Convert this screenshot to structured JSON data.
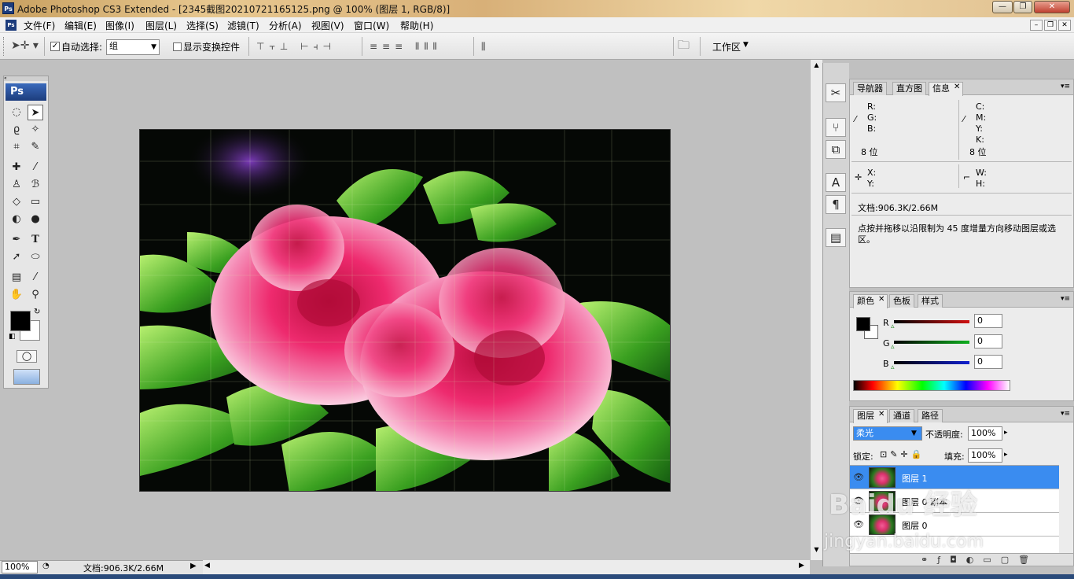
{
  "titlebar": {
    "title": "Adobe Photoshop CS3 Extended - [2345截图20210721165125.png @ 100% (图层 1, RGB/8)]",
    "logo": "Ps"
  },
  "menu": {
    "items": [
      "文件(F)",
      "编辑(E)",
      "图像(I)",
      "图层(L)",
      "选择(S)",
      "滤镜(T)",
      "分析(A)",
      "视图(V)",
      "窗口(W)",
      "帮助(H)"
    ]
  },
  "options": {
    "auto_select_label": "自动选择:",
    "auto_select_value": "组",
    "show_transform_label": "显示变换控件",
    "workspace_label": "工作区"
  },
  "toolbox": {
    "logo": "Ps"
  },
  "status": {
    "zoom": "100%",
    "doc_size": "文档:906.3K/2.66M"
  },
  "info_panel": {
    "tabs": [
      "导航器",
      "直方图",
      "信息"
    ],
    "active_tab": "信息",
    "rgb": [
      "R:",
      "G:",
      "B:"
    ],
    "cmyk": [
      "C:",
      "M:",
      "Y:",
      "K:"
    ],
    "bits_left": "8 位",
    "bits_right": "8 位",
    "xy": [
      "X:",
      "Y:"
    ],
    "wh": [
      "W:",
      "H:"
    ],
    "doc_size": "文档:906.3K/2.66M",
    "hint": "点按并拖移以沿限制为 45 度增量方向移动图层或选区。"
  },
  "color_panel": {
    "tabs": [
      "颜色",
      "色板",
      "样式"
    ],
    "active_tab": "颜色",
    "channels": [
      {
        "label": "R",
        "value": "0"
      },
      {
        "label": "G",
        "value": "0"
      },
      {
        "label": "B",
        "value": "0"
      }
    ],
    "colors": {
      "r": "#d01010",
      "g": "#10b020",
      "b": "#1020d0"
    }
  },
  "layers_panel": {
    "tabs": [
      "图层",
      "通道",
      "路径"
    ],
    "active_tab": "图层",
    "blend_mode": "柔光",
    "opacity_label": "不透明度:",
    "opacity_value": "100%",
    "lock_label": "锁定:",
    "fill_label": "填充:",
    "fill_value": "100%",
    "layers": [
      {
        "name": "图层 1",
        "selected": true
      },
      {
        "name": "图层 0 副本",
        "selected": false
      },
      {
        "name": "图层 0",
        "selected": false
      }
    ]
  },
  "watermark": {
    "brand": "Baidu 经验",
    "url": "jingyan.baidu.com"
  }
}
